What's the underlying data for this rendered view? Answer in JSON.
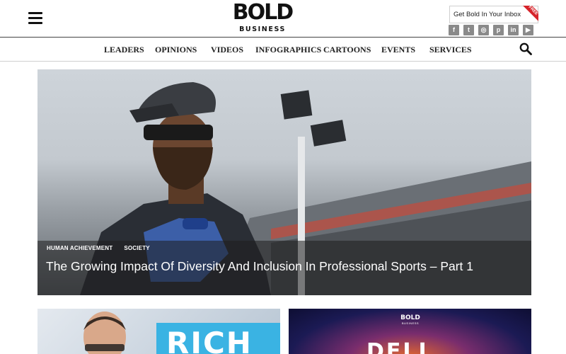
{
  "header": {
    "menu_icon": "hamburger-icon",
    "logo": {
      "line1": "BOLD",
      "line2": "BUSINESS"
    },
    "newsletter": {
      "label": "Get Bold In Your Inbox",
      "badge": "FREE"
    },
    "social": [
      {
        "name": "facebook-icon",
        "glyph": "f"
      },
      {
        "name": "twitter-icon",
        "glyph": "t"
      },
      {
        "name": "instagram-icon",
        "glyph": "◎"
      },
      {
        "name": "pinterest-icon",
        "glyph": "p"
      },
      {
        "name": "linkedin-icon",
        "glyph": "in"
      },
      {
        "name": "youtube-icon",
        "glyph": "▶"
      }
    ]
  },
  "nav": {
    "items": [
      "LEADERS",
      "OPINIONS",
      "VIDEOS",
      "INFOGRAPHICS",
      "CARTOONS",
      "EVENTS",
      "SERVICES"
    ],
    "search_icon": "search-icon"
  },
  "hero": {
    "tags": [
      "HUMAN ACHIEVEMENT",
      "SOCIETY"
    ],
    "title": "The Growing Impact Of Diversity And Inclusion In Professional Sports – Part 1"
  },
  "cards": [
    {
      "text": "RICH"
    },
    {
      "logo_line1": "BOLD",
      "logo_line2": "BUSINESS",
      "text": "DELL"
    }
  ],
  "colors": {
    "accent_red": "#d6232a",
    "social_gray": "#8a8a8a",
    "card_blue": "#3ab3e3"
  }
}
